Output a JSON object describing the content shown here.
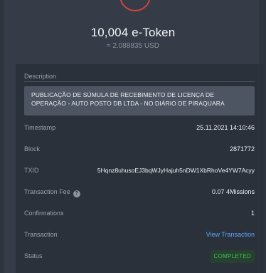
{
  "header": {
    "amount": "10,004 e-Token",
    "usd": "≈ 2.088835 USD",
    "icon": "token-logo-icon"
  },
  "description": {
    "label": "Description",
    "text": "PUBLICAÇÃO DE SÚMULA DE RECEBIMENTO DE LICENÇA DE OPERAÇÃO - AUTO POSTO DB LTDA - NO DIÁRIO DE PIRAQUARA"
  },
  "details": {
    "timestamp_label": "Timestamp",
    "timestamp": "25.11.2021 14:10:46",
    "block_label": "Block",
    "block": "2871772",
    "txid_label": "TXID",
    "txid": "5Hqnz8uhusoEJ3bqWJyHajuh5nDW1XbRhoVe4YW7Acyy",
    "fee_label": "Transaction Fee",
    "fee_info_icon": "?",
    "fee": "0.07 4Missions",
    "confirmations_label": "Confirmations",
    "confirmations": "1",
    "transaction_label": "Transaction",
    "transaction_link": "View Transaction",
    "status_label": "Status",
    "status": "COMPLETED"
  },
  "colors": {
    "background": "#353c47",
    "panel": "#2b313a",
    "link": "#5aa6ff",
    "status_success": "#39c05a",
    "accent_icon": "#d0443e"
  }
}
